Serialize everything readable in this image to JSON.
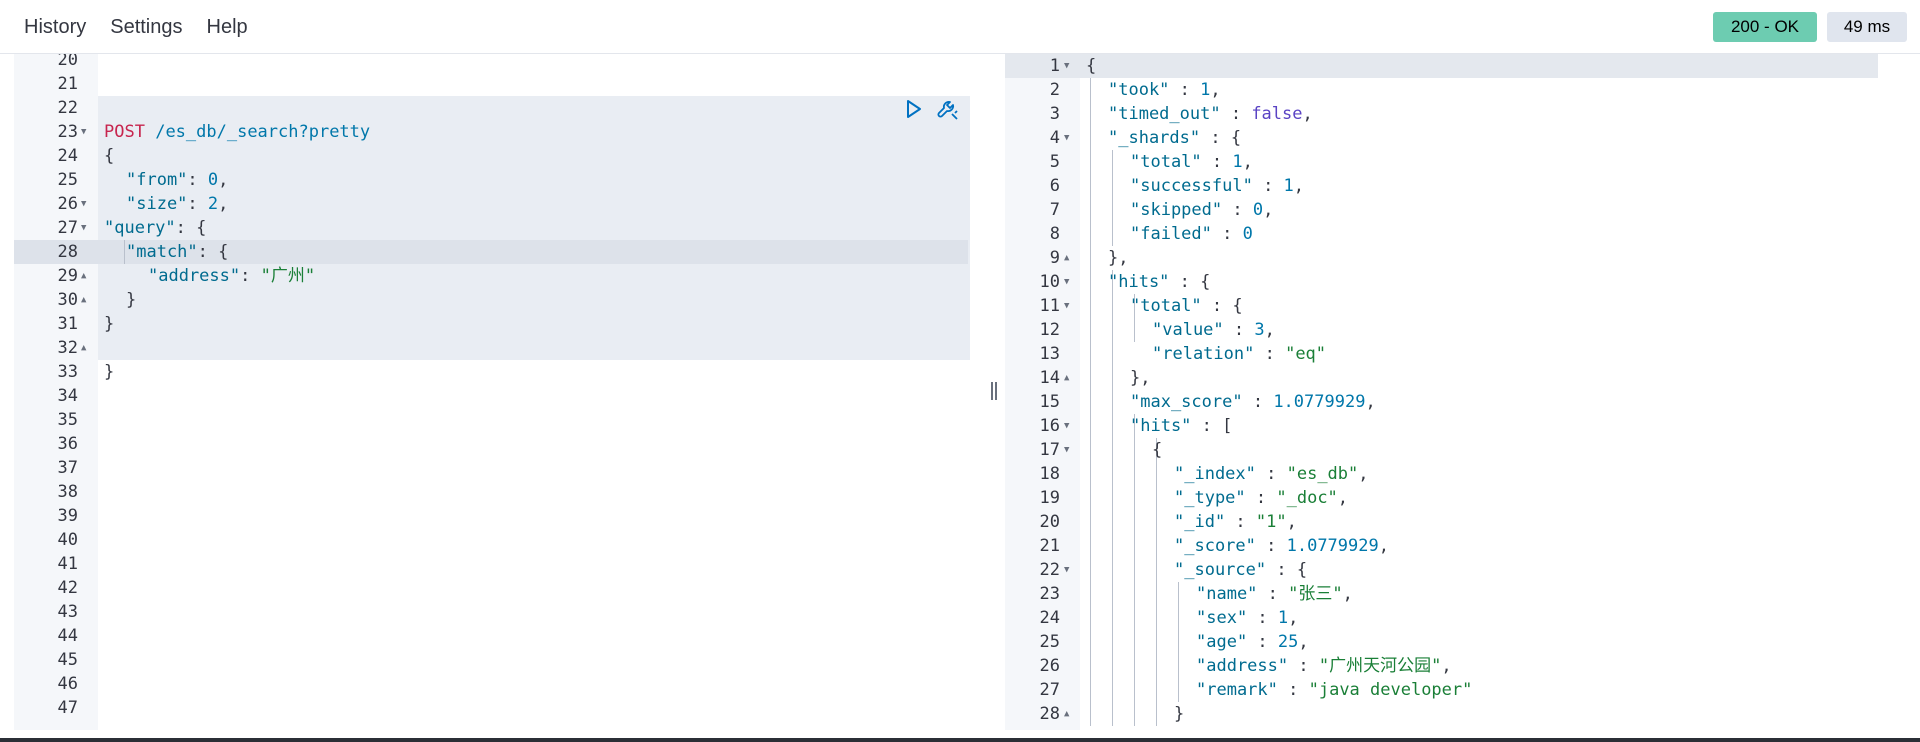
{
  "menu": {
    "history": "History",
    "settings": "Settings",
    "help": "Help"
  },
  "status": {
    "code_label": "200 - OK",
    "time_label": "49 ms",
    "ok_color": "#6dccb1"
  },
  "request": {
    "line_numbers": [
      "20",
      "21",
      "22",
      "23",
      "24",
      "25",
      "26",
      "27",
      "28",
      "29",
      "30",
      "31",
      "32",
      "33",
      "34",
      "35",
      "36",
      "37",
      "38",
      "39",
      "40",
      "41",
      "42",
      "43",
      "44",
      "45",
      "46",
      "47"
    ],
    "method": "POST",
    "url": "/es_db/_search?pretty",
    "body": {
      "open_brace": "{",
      "from_key": "\"from\"",
      "from_val": "0",
      "size_key": "\"size\"",
      "size_val": "2",
      "query_key": "\"query\"",
      "match_key": "\"match\"",
      "address_key": "\"address\"",
      "address_val": "\"广州\"",
      "close_match": "}",
      "close_query": "}",
      "close_body": "}"
    },
    "actions": {
      "run": "play-icon",
      "settings": "wrench-icon"
    }
  },
  "response": {
    "line_numbers": [
      "1",
      "2",
      "3",
      "4",
      "5",
      "6",
      "7",
      "8",
      "9",
      "10",
      "11",
      "12",
      "13",
      "14",
      "15",
      "16",
      "17",
      "18",
      "19",
      "20",
      "21",
      "22",
      "23",
      "24",
      "25",
      "26",
      "27",
      "28"
    ],
    "took_key": "\"took\"",
    "took_val": "1",
    "timed_out_key": "\"timed_out\"",
    "timed_out_val": "false",
    "shards_key": "\"_shards\"",
    "total_key": "\"total\"",
    "total_val": "1",
    "successful_key": "\"successful\"",
    "successful_val": "1",
    "skipped_key": "\"skipped\"",
    "skipped_val": "0",
    "failed_key": "\"failed\"",
    "failed_val": "0",
    "hits_key": "\"hits\"",
    "hits_total_key": "\"total\"",
    "value_key": "\"value\"",
    "value_val": "3",
    "relation_key": "\"relation\"",
    "relation_val": "\"eq\"",
    "max_score_key": "\"max_score\"",
    "max_score_val": "1.0779929",
    "inner_hits_key": "\"hits\"",
    "index_key": "\"_index\"",
    "index_val": "\"es_db\"",
    "type_key": "\"_type\"",
    "type_val": "\"_doc\"",
    "id_key": "\"_id\"",
    "id_val": "\"1\"",
    "score_key": "\"_score\"",
    "score_val": "1.0779929",
    "source_key": "\"_source\"",
    "name_key": "\"name\"",
    "name_val": "\"张三\"",
    "sex_key": "\"sex\"",
    "sex_val": "1",
    "age_key": "\"age\"",
    "age_val": "25",
    "address_key": "\"address\"",
    "address_val": "\"广州天河公园\"",
    "remark_key": "\"remark\"",
    "remark_val": "\"java developer\""
  }
}
